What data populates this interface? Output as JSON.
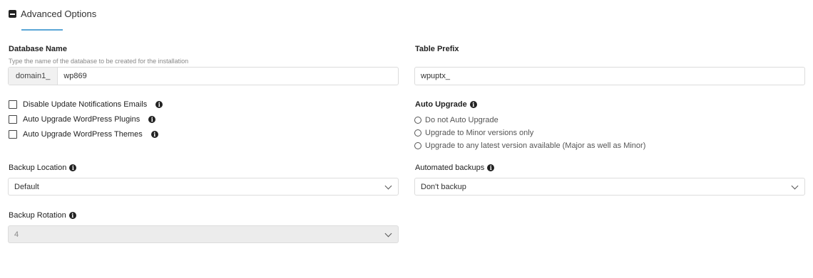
{
  "section": {
    "title": "Advanced Options"
  },
  "database_name": {
    "label": "Database Name",
    "hint": "Type the name of the database to be created for the installation",
    "prefix": "domain1_",
    "value": "wp869"
  },
  "table_prefix": {
    "label": "Table Prefix",
    "value": "wpuptx_"
  },
  "checkboxes": [
    {
      "label": "Disable Update Notifications Emails",
      "checked": false
    },
    {
      "label": "Auto Upgrade WordPress Plugins",
      "checked": false
    },
    {
      "label": "Auto Upgrade WordPress Themes",
      "checked": false
    }
  ],
  "auto_upgrade": {
    "label": "Auto Upgrade",
    "options": [
      "Do not Auto Upgrade",
      "Upgrade to Minor versions only",
      "Upgrade to any latest version available (Major as well as Minor)"
    ]
  },
  "backup_location": {
    "label": "Backup Location",
    "value": "Default"
  },
  "automated_backups": {
    "label": "Automated backups",
    "value": "Don't backup"
  },
  "backup_rotation": {
    "label": "Backup Rotation",
    "value": "4"
  },
  "icons": {
    "info": "info-icon",
    "collapse": "minus-square-icon",
    "dropdown": "chevron-down-icon"
  },
  "colors": {
    "accent": "#5aa6d6"
  }
}
